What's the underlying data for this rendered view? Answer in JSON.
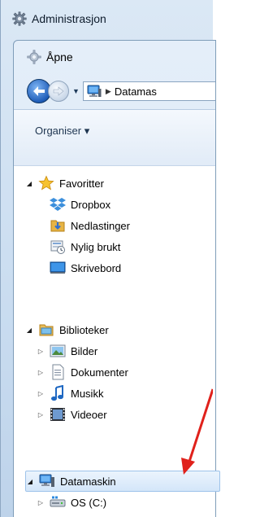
{
  "outer_window": {
    "title": "Administrasjon",
    "icon": "gear-icon"
  },
  "dialog": {
    "title": "Åpne",
    "icon": "gear-icon"
  },
  "navigation": {
    "address_segments": [
      "Datamas"
    ],
    "address_icon": "computer-icon"
  },
  "command_bar": {
    "organise_label": "Organiser ▾"
  },
  "tree": {
    "favorites": {
      "label": "Favoritter",
      "icon": "star-icon",
      "items": [
        {
          "label": "Dropbox",
          "icon": "dropbox-icon"
        },
        {
          "label": "Nedlastinger",
          "icon": "downloads-icon"
        },
        {
          "label": "Nylig brukt",
          "icon": "recent-places-icon"
        },
        {
          "label": "Skrivebord",
          "icon": "desktop-icon"
        }
      ]
    },
    "libraries": {
      "label": "Biblioteker",
      "icon": "libraries-icon",
      "items": [
        {
          "label": "Bilder",
          "icon": "pictures-icon"
        },
        {
          "label": "Dokumenter",
          "icon": "documents-icon"
        },
        {
          "label": "Musikk",
          "icon": "music-icon"
        },
        {
          "label": "Videoer",
          "icon": "videos-icon"
        }
      ]
    },
    "computer": {
      "label": "Datamaskin",
      "icon": "computer-icon",
      "selected": true,
      "items": [
        {
          "label": "OS (C:)",
          "icon": "drive-icon"
        }
      ]
    }
  },
  "annotation": {
    "color": "#e0211b"
  }
}
